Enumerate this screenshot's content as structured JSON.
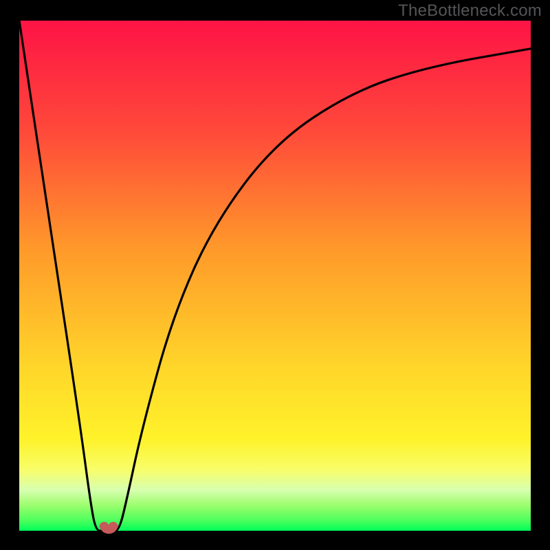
{
  "watermark": "TheBottleneck.com",
  "chart_data": {
    "type": "line",
    "title": "",
    "xlabel": "",
    "ylabel": "",
    "xlim": [
      0,
      100
    ],
    "ylim": [
      0,
      100
    ],
    "grid": false,
    "legend": false,
    "curve_points": [
      {
        "x": 0.0,
        "y": 100.0
      },
      {
        "x": 6.0,
        "y": 60.0
      },
      {
        "x": 12.0,
        "y": 20.0
      },
      {
        "x": 14.0,
        "y": 5.0
      },
      {
        "x": 15.0,
        "y": 0.0
      },
      {
        "x": 16.5,
        "y": 0.0
      },
      {
        "x": 17.2,
        "y": 0.8
      },
      {
        "x": 18.0,
        "y": 0.0
      },
      {
        "x": 19.5,
        "y": 0.0
      },
      {
        "x": 21.0,
        "y": 6.0
      },
      {
        "x": 24.0,
        "y": 20.0
      },
      {
        "x": 30.0,
        "y": 42.0
      },
      {
        "x": 38.0,
        "y": 60.0
      },
      {
        "x": 50.0,
        "y": 76.0
      },
      {
        "x": 65.0,
        "y": 86.0
      },
      {
        "x": 80.0,
        "y": 91.0
      },
      {
        "x": 100.0,
        "y": 94.5
      }
    ],
    "marker": {
      "x": 17.2,
      "y": 0.8,
      "color": "#c65a5a"
    },
    "background_gradient": {
      "top": "#fd1345",
      "mid1": "#ff6b2d",
      "mid2": "#ffd02a",
      "band": "#f8fe69",
      "bottom_band": "#9cfe6e",
      "bottom": "#00ff5a"
    },
    "plot_border_color": "#000000",
    "plot_border_width_px": 28
  }
}
